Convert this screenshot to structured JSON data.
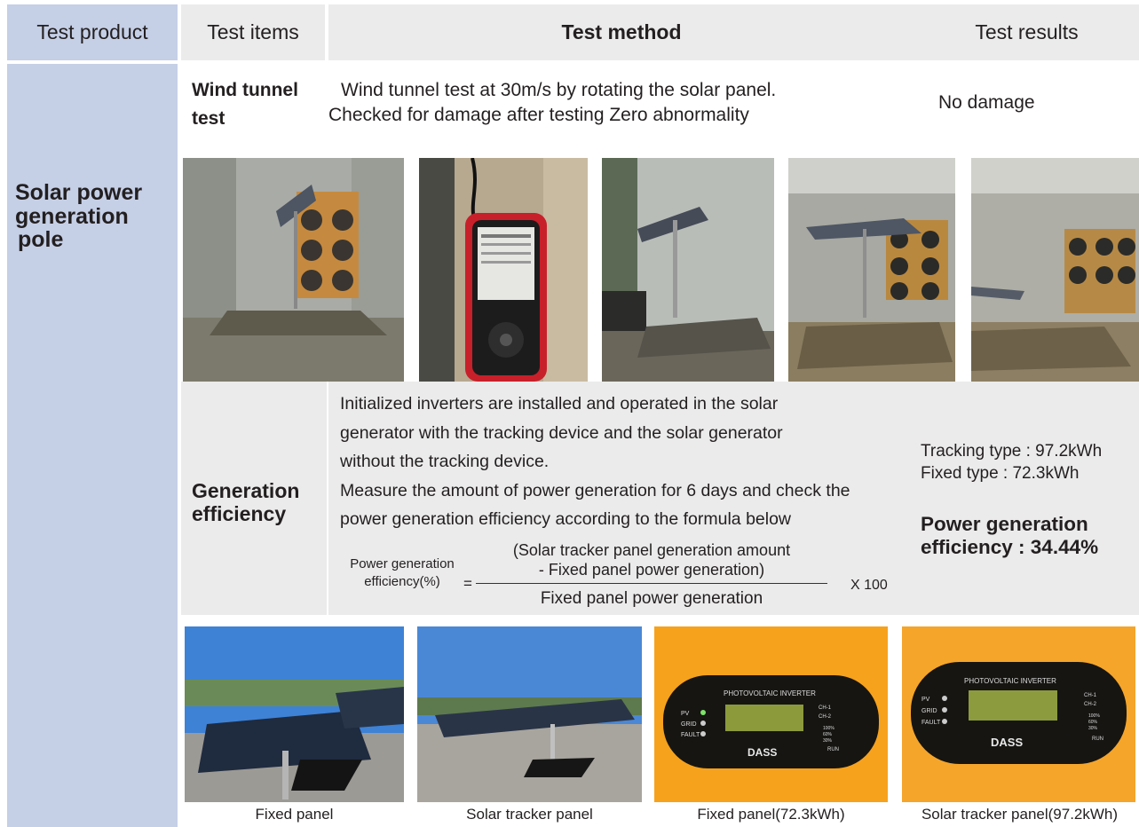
{
  "header": {
    "product": "Test product",
    "items": "Test items",
    "method": "Test method",
    "results": "Test results"
  },
  "product": {
    "name_lines": [
      "Solar power",
      "generation",
      "pole"
    ]
  },
  "wind_test": {
    "item_lines": [
      "Wind tunnel",
      "test"
    ],
    "method_lines": [
      "Wind tunnel test at 30m/s by rotating the solar panel.",
      "Checked for damage after testing Zero abnormality"
    ],
    "result": "No damage",
    "photos": [
      {
        "name": "wind-tunnel-photo-1"
      },
      {
        "name": "anemometer-photo"
      },
      {
        "name": "wind-tunnel-photo-2"
      },
      {
        "name": "wind-tunnel-photo-3"
      },
      {
        "name": "wind-tunnel-photo-4"
      }
    ]
  },
  "generation": {
    "item_lines": [
      "Generation",
      "efficiency"
    ],
    "method_lines": [
      "Initialized inverters are installed and operated in the solar",
      "generator with the tracking device and the solar generator",
      "without the tracking device.",
      "Measure the amount of power generation for 6 days and check the",
      "power generation efficiency according to the formula below"
    ],
    "formula": {
      "lhs_lines": [
        "Power generation",
        "efficiency(%)"
      ],
      "equals": "=",
      "numerator_lines": [
        "(Solar tracker panel generation amount",
        "- Fixed panel power generation)"
      ],
      "denominator": "Fixed panel power generation",
      "multiplier": "X 100"
    },
    "results": {
      "tracking": "Tracking type  : 97.2kWh",
      "fixed": "Fixed type : 72.3kWh",
      "efficiency_lines": [
        "Power generation",
        "efficiency : 34.44%"
      ]
    },
    "photos": [
      {
        "caption": "Fixed panel"
      },
      {
        "caption": "Solar tracker panel"
      },
      {
        "caption": "Fixed panel(72.3kWh)"
      },
      {
        "caption": "Solar tracker panel(97.2kWh)"
      }
    ],
    "inverter": {
      "title": "PHOTOVOLTAIC INVERTER",
      "brand": "DASS",
      "leds": [
        "PV",
        "GRID",
        "FAULT"
      ],
      "channels": [
        "CH-1",
        "CH-2"
      ],
      "levels": [
        "100%",
        "60%",
        "30%"
      ],
      "run": "RUN"
    }
  },
  "colors": {
    "header_grey": "#ebebeb",
    "product_blue": "#c5cfe6",
    "text": "#231f20",
    "inverter_orange": "#f6a21d"
  }
}
